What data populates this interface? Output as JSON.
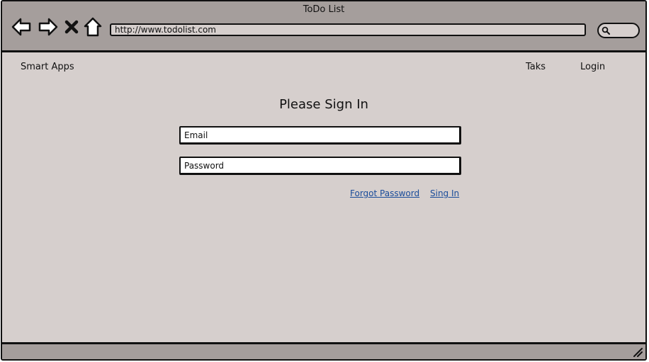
{
  "window": {
    "title": "ToDo List"
  },
  "browser": {
    "url": "http://www.todolist.com",
    "icons": [
      "back-arrow-icon",
      "forward-arrow-icon",
      "close-x-icon",
      "home-icon",
      "search-icon"
    ]
  },
  "nav": {
    "brand": "Smart Apps",
    "links": [
      "Taks",
      "Login"
    ]
  },
  "signin": {
    "heading": "Please Sign In",
    "email_placeholder": "Email",
    "password_placeholder": "Password",
    "forgot_label": "Forgot Password",
    "signin_label": "Sing In"
  },
  "colors": {
    "chrome": "#a59e9c",
    "background": "#d6cfcd",
    "link": "#1a4c9a"
  }
}
